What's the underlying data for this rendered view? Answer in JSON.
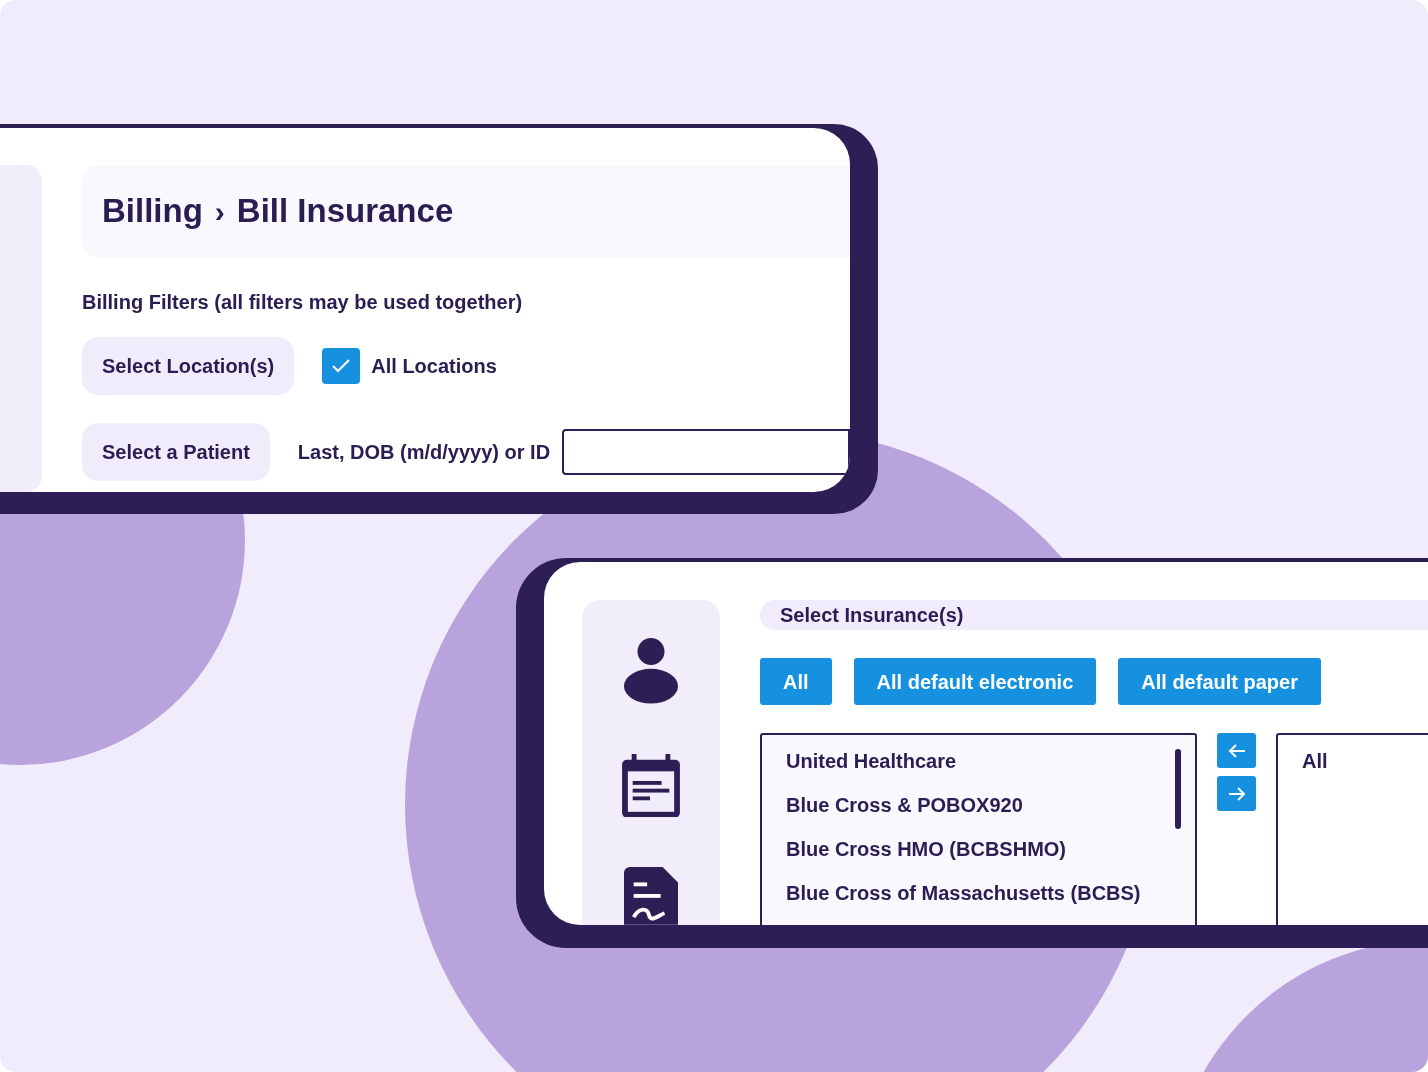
{
  "billing_window": {
    "breadcrumb": {
      "section": "Billing",
      "separator": "›",
      "page": "Bill Insurance"
    },
    "filters_heading": "Billing Filters (all filters may be used together)",
    "location": {
      "button": "Select Location(s)",
      "all_locations": {
        "label": "All Locations",
        "checked": true
      }
    },
    "patient": {
      "button": "Select a Patient",
      "field_label": "Last, DOB (m/d/yyyy) or ID"
    }
  },
  "insurance_window": {
    "header": "Select Insurance(s)",
    "quick_buttons": [
      "All",
      "All default electronic",
      "All default paper"
    ],
    "available": [
      "United Healthcare",
      "Blue Cross & POBOX920",
      "Blue Cross HMO (BCBSHMO)",
      "Blue Cross of Massachusetts (BCBS)"
    ],
    "chosen": [
      "All"
    ]
  }
}
